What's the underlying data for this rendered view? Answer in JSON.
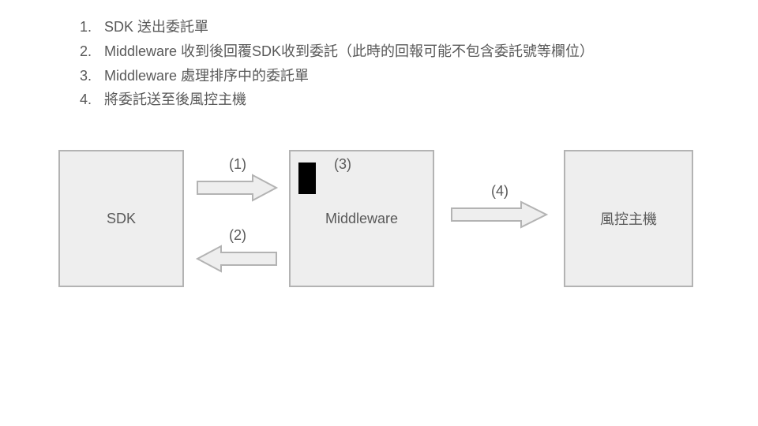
{
  "list": {
    "items": [
      {
        "num": "1.",
        "text": "SDK 送出委託單"
      },
      {
        "num": "2.",
        "text": "Middleware 收到後回覆SDK收到委託（此時的回報可能不包含委託號等欄位）"
      },
      {
        "num": "3.",
        "text": "Middleware 處理排序中的委託單"
      },
      {
        "num": "4.",
        "text": "將委託送至後風控主機"
      }
    ]
  },
  "boxes": {
    "sdk": {
      "label": "SDK"
    },
    "middleware": {
      "label": "Middleware"
    },
    "risk": {
      "label": "風控主機"
    }
  },
  "arrows": {
    "a1": {
      "label": "(1)"
    },
    "a2": {
      "label": "(2)"
    },
    "a3": {
      "label": "(3)"
    },
    "a4": {
      "label": "(4)"
    }
  },
  "colors": {
    "box_fill": "#eeeeee",
    "box_border": "#b3b3b3",
    "arrow_fill": "#eeeeee",
    "arrow_border": "#b3b3b3",
    "text": "#595959"
  }
}
